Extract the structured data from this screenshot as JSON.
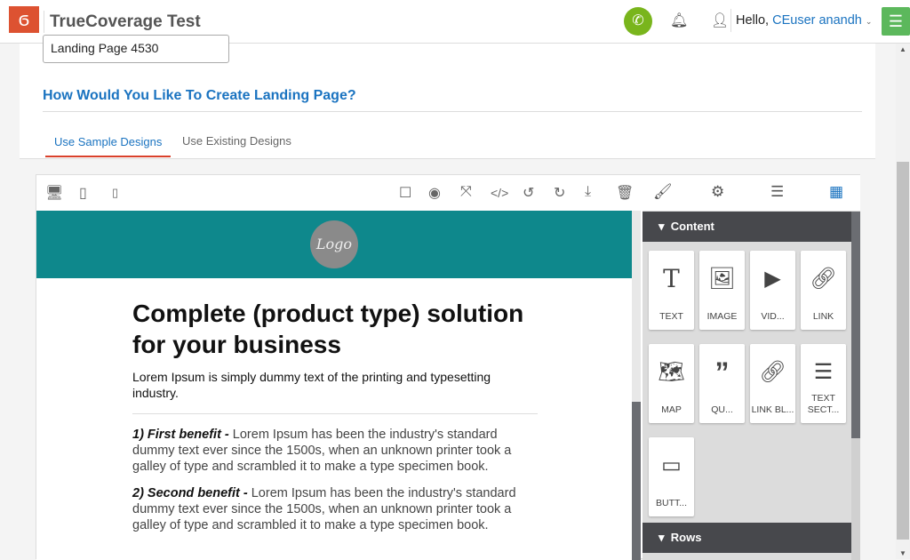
{
  "header": {
    "app_title": "TrueCoverage Test",
    "greeting": "Hello,",
    "user_name": "CEuser anandh"
  },
  "form": {
    "page_name_value": "Landing Page 4530",
    "question": "How Would You Like To Create Landing Page?",
    "tabs": [
      {
        "label": "Use Sample Designs",
        "active": true
      },
      {
        "label": "Use Existing Designs",
        "active": false
      }
    ]
  },
  "canvas": {
    "logo_text": "Logo",
    "headline": "Complete (product type) solution for your business",
    "intro": "Lorem Ipsum is simply dummy text of the printing and typesetting industry.",
    "benefits": [
      {
        "title": "1) First benefit -",
        "text": " Lorem Ipsum has been the industry's standard dummy text ever since the 1500s, when an unknown printer took a galley of type and scrambled it to make a type specimen book."
      },
      {
        "title": "2) Second benefit -",
        "text": " Lorem Ipsum has been the industry's standard dummy text ever since the 1500s, when an unknown printer took a galley of type and scrambled it to make a type specimen book."
      }
    ]
  },
  "panel": {
    "content_label": "Content",
    "rows_label": "Rows",
    "tiles": [
      "TEXT",
      "IMAGE",
      "VID...",
      "LINK",
      "MAP",
      "QU...",
      "LINK BL...",
      "TEXT SECT...",
      "BUTT..."
    ]
  },
  "colors": {
    "brand": "#dd5231",
    "accent": "#1a73c0",
    "banner": "#0e888c"
  }
}
